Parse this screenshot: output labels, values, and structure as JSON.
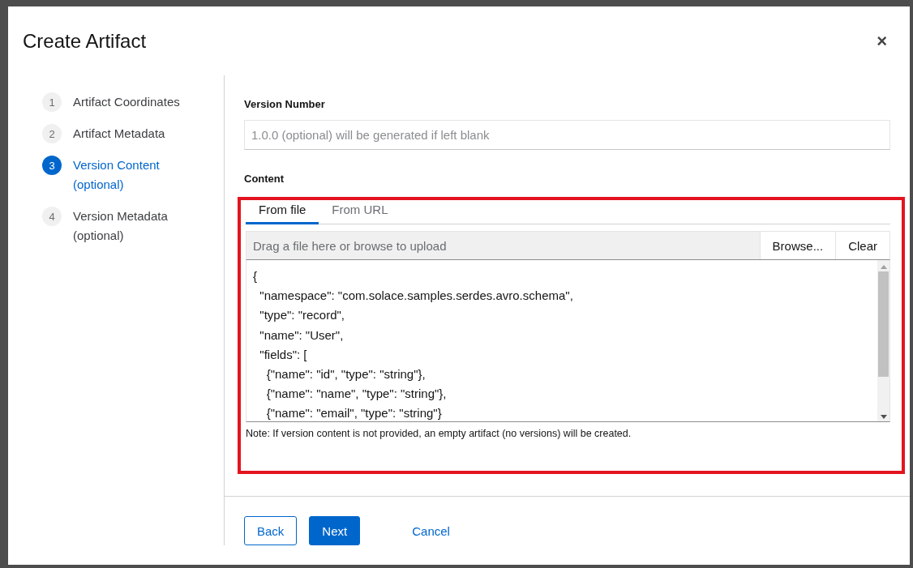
{
  "dialog": {
    "title": "Create Artifact",
    "close": "×"
  },
  "steps": [
    {
      "number": "1",
      "label": "Artifact Coordinates",
      "selected": false
    },
    {
      "number": "2",
      "label": "Artifact Metadata",
      "selected": false
    },
    {
      "number": "3",
      "label": "Version Content (optional)",
      "selected": true
    },
    {
      "number": "4",
      "label": "Version Metadata (optional)",
      "selected": false
    }
  ],
  "version_number": {
    "label": "Version Number",
    "placeholder": "1.0.0 (optional) will be generated if left blank"
  },
  "content": {
    "label": "Content",
    "tabs": [
      {
        "label": "From file",
        "selected": true
      },
      {
        "label": "From URL",
        "selected": false
      }
    ],
    "upload": {
      "placeholder": "Drag a file here or browse to upload",
      "browse": "Browse...",
      "clear": "Clear"
    },
    "lines": [
      "{",
      "  \"namespace\": \"com.solace.samples.serdes.avro.schema\",",
      "  \"type\": \"record\",",
      "  \"name\": \"User\",",
      "  \"fields\": [",
      "    {\"name\": \"id\", \"type\": \"string\"},",
      "    {\"name\": \"name\", \"type\": \"string\"},",
      "    {\"name\": \"email\", \"type\": \"string\"}"
    ],
    "note": "Note: If version content is not provided, an empty artifact (no versions) will be created."
  },
  "footer": {
    "back": "Back",
    "next": "Next",
    "cancel": "Cancel"
  }
}
